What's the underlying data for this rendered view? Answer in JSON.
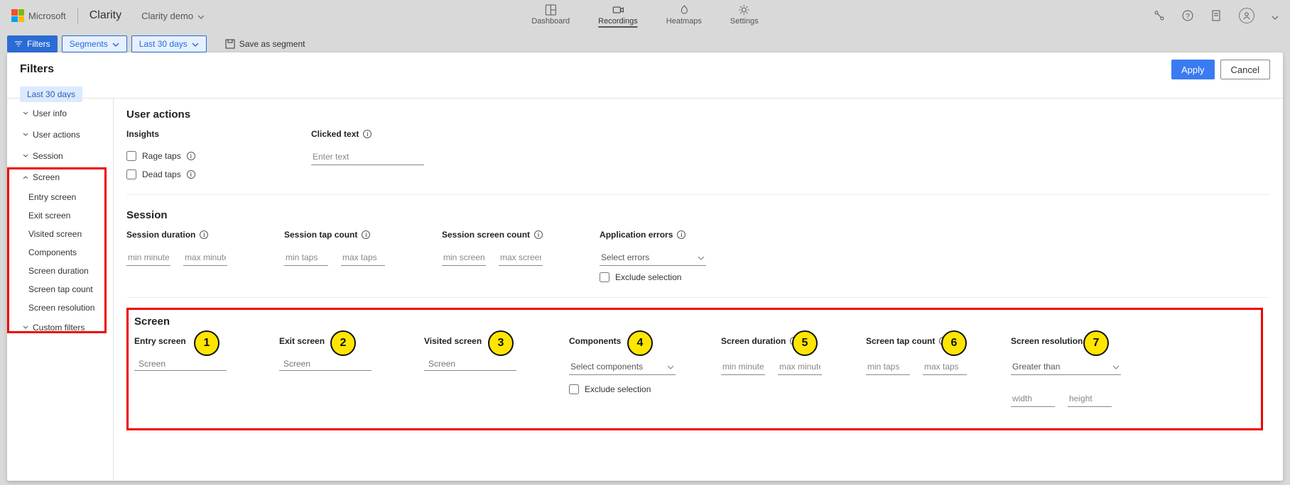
{
  "header": {
    "brand_ms": "Microsoft",
    "brand_product": "Clarity",
    "project": "Clarity demo",
    "nav": {
      "dashboard": "Dashboard",
      "recordings": "Recordings",
      "heatmaps": "Heatmaps",
      "settings": "Settings"
    }
  },
  "toolbar": {
    "filters": "Filters",
    "segments": "Segments",
    "dates": "Last 30 days",
    "save_segment": "Save as segment"
  },
  "panel": {
    "title": "Filters",
    "apply": "Apply",
    "cancel": "Cancel",
    "chip": "Last 30 days"
  },
  "sidebar": {
    "user_info": "User info",
    "user_actions": "User actions",
    "session": "Session",
    "screen": "Screen",
    "screen_items": [
      "Entry screen",
      "Exit screen",
      "Visited screen",
      "Components",
      "Screen duration",
      "Screen tap count",
      "Screen resolution"
    ],
    "custom_filters": "Custom filters"
  },
  "user_actions": {
    "title": "User actions",
    "insights_label": "Insights",
    "rage_taps": "Rage taps",
    "dead_taps": "Dead taps",
    "clicked_text_label": "Clicked text",
    "clicked_text_placeholder": "Enter text"
  },
  "session": {
    "title": "Session",
    "duration_label": "Session duration",
    "tap_count_label": "Session tap count",
    "screen_count_label": "Session screen count",
    "app_errors_label": "Application errors",
    "min_minutes": "min minutes",
    "max_minutes": "max minutes",
    "min_taps": "min taps",
    "max_taps": "max taps",
    "min_screens": "min screens",
    "max_screens": "max screens",
    "select_errors": "Select errors",
    "exclude": "Exclude selection"
  },
  "screen": {
    "title": "Screen",
    "entry": "Entry screen",
    "exit": "Exit screen",
    "visited": "Visited screen",
    "components": "Components",
    "duration": "Screen duration",
    "tap_count": "Screen tap count",
    "resolution": "Screen resolution",
    "search_placeholder": "Screen",
    "select_components": "Select components",
    "exclude": "Exclude selection",
    "min_minutes": "min minutes",
    "max_minutes": "max minutes",
    "min_taps": "min taps",
    "max_taps": "max taps",
    "res_mode": "Greater than",
    "width": "width",
    "height": "height",
    "badges": [
      "1",
      "2",
      "3",
      "4",
      "5",
      "6",
      "7"
    ]
  }
}
